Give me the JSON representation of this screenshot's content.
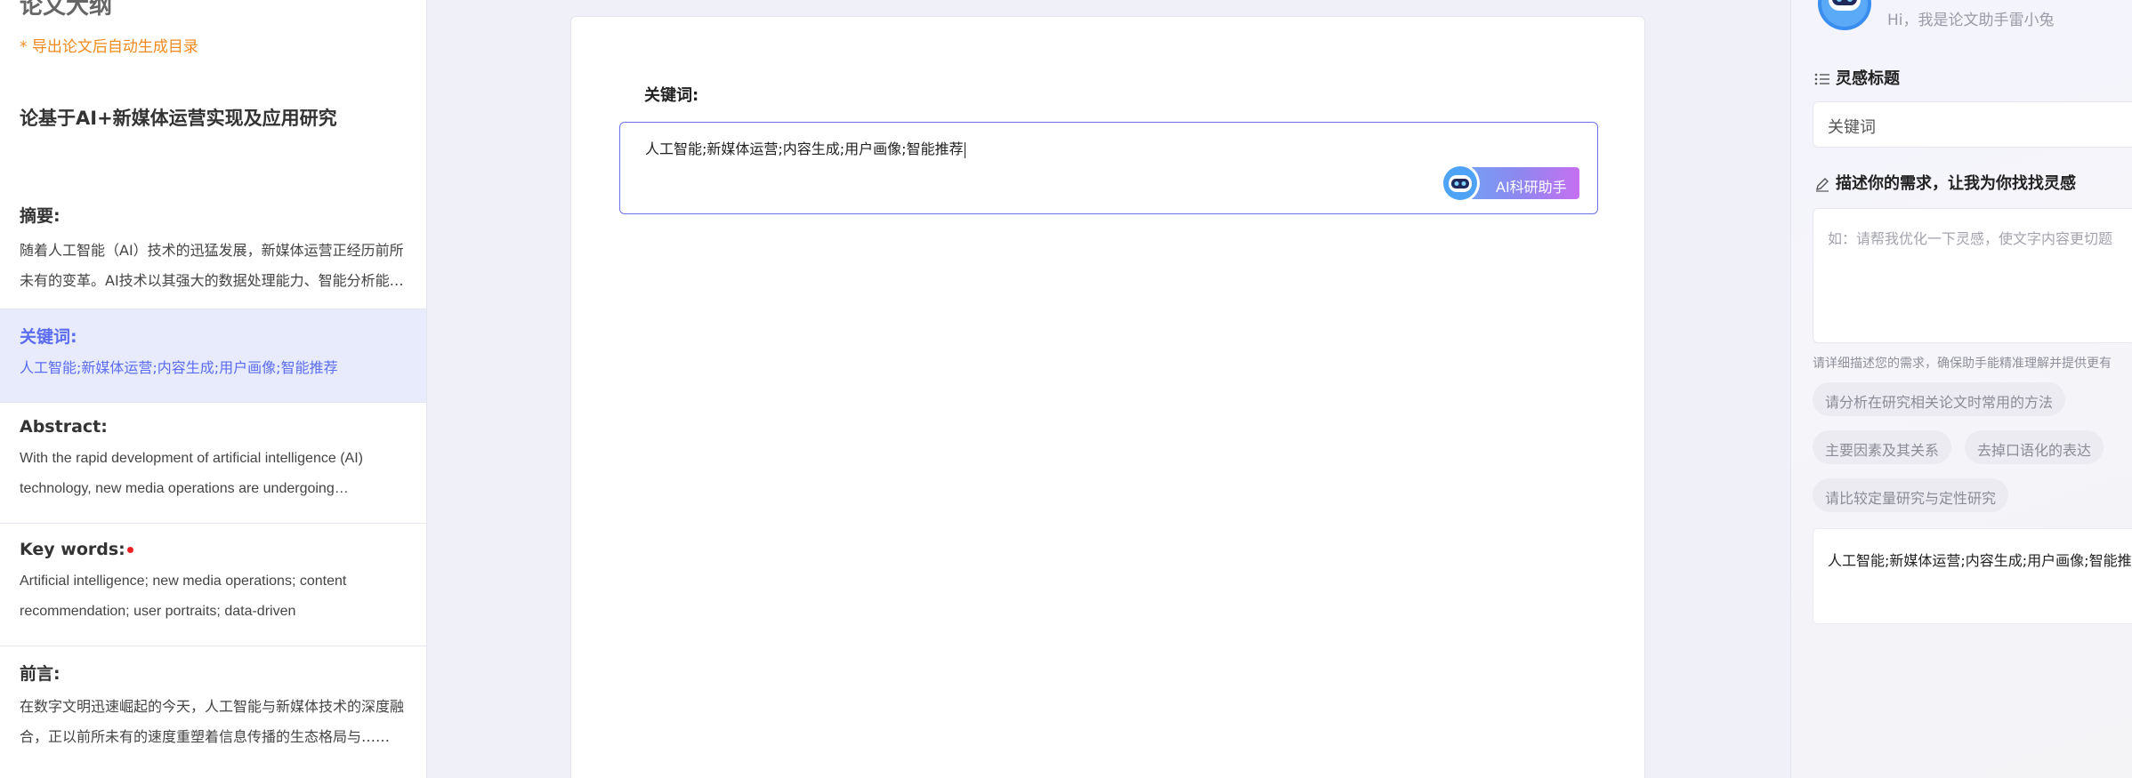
{
  "outline": {
    "title": "论文大纲",
    "notice": "* 导出论文后自动生成目录",
    "paper_title": "论基于AI+新媒体运营实现及应用研究",
    "sections": [
      {
        "heading": "摘要:",
        "text": "随着人工智能（AI）技术的迅猛发展，新媒体运营正经历前所未有的变革。AI技术以其强大的数据处理能力、智能分析能力……"
      },
      {
        "heading": "关键词:",
        "text": "人工智能;新媒体运营;内容生成;用户画像;智能推荐"
      },
      {
        "heading": "Abstract:",
        "text": "With the rapid development of artificial intelligence (AI) technology, new media operations are undergoing…"
      },
      {
        "heading": "Key words:",
        "text": "Artificial intelligence; new media operations; content recommendation; user portraits; data-driven"
      },
      {
        "heading": "前言:",
        "text": "在数字文明迅速崛起的今天，人工智能与新媒体技术的深度融合，正以前所未有的速度重塑着信息传播的生态格局与……"
      }
    ]
  },
  "editor": {
    "label": "关键词:",
    "value": "人工智能;新媒体运营;内容生成;用户画像;智能推荐",
    "ai_button": "AI科研助手"
  },
  "assistant": {
    "greeting": "Hi，我是论文助手雷小兔",
    "inspiration_title": "灵感标题",
    "inspiration_value": "关键词",
    "request_title": "描述你的需求，让我为你找找灵感",
    "request_placeholder": "如：请帮我优化一下灵感，使文字内容更切题",
    "hint": "请详细描述您的需求，确保助手能精准理解并提供更有",
    "chips": [
      "请分析在研究相关论文时常用的方法",
      "主要因素及其关系",
      "去掉口语化的表达",
      "请比较定量研究与定性研究"
    ],
    "result": "人工智能;新媒体运营;内容生成;用户画像;智能推荐"
  },
  "colors": {
    "accent": "#5b6cf0",
    "notice": "#f08a1d",
    "active_bg": "#e8ebfb"
  },
  "icons": [
    "robot-avatar-icon",
    "list-icon",
    "pencil-icon",
    "red-dot-icon"
  ]
}
